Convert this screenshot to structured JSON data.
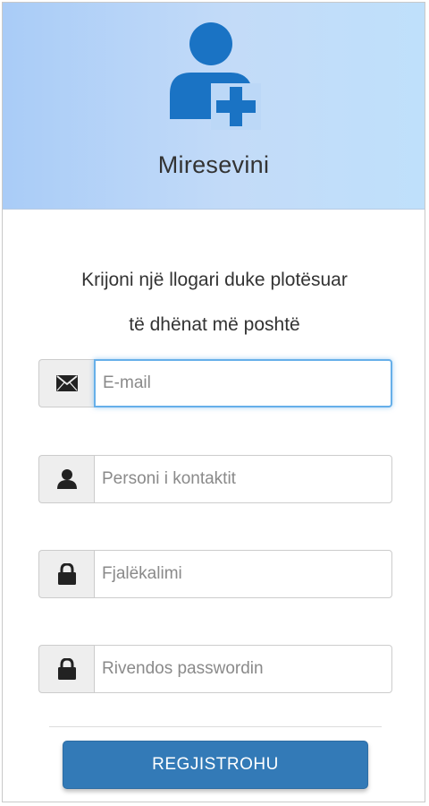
{
  "header": {
    "icon": "user-add-icon",
    "title": "Miresevini",
    "colors": {
      "icon": "#1a73c4",
      "gradient_left": "#a9ccf7",
      "gradient_right": "#bfe0fb"
    }
  },
  "intro": {
    "line1": "Krijoni një llogari duke plotësuar",
    "line2": "të dhënat më poshtë"
  },
  "form": {
    "fields": [
      {
        "icon": "envelope-icon",
        "placeholder": "E-mail",
        "value": "",
        "focused": true
      },
      {
        "icon": "user-icon",
        "placeholder": "Personi i kontaktit",
        "value": ""
      },
      {
        "icon": "lock-icon",
        "placeholder": "Fjalëkalimi",
        "value": ""
      },
      {
        "icon": "lock-icon",
        "placeholder": "Rivendos passwordin",
        "value": ""
      }
    ],
    "submit_label": "REGJISTROHU",
    "colors": {
      "button": "#337ab7",
      "focus": "#66afe9"
    }
  }
}
